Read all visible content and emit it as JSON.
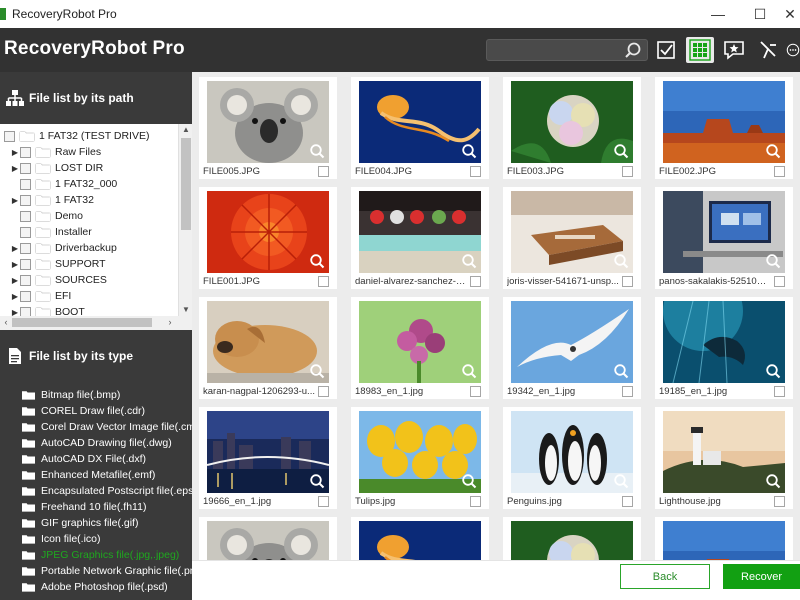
{
  "window": {
    "title": "RecoveryRobot Pro",
    "minimize_glyph": "—",
    "maximize_glyph": "☐",
    "close_glyph": "✕"
  },
  "header": {
    "app_title": "RecoveryRobot Pro",
    "search_value": "",
    "toolbar_icons": [
      "search-icon",
      "select-all-icon",
      "grid-view-icon",
      "preview-icon",
      "filter-icon",
      "more-icon"
    ]
  },
  "path_panel": {
    "title": "File list by its path",
    "tree": [
      {
        "label": "1 FAT32 (TEST DRIVE)",
        "arrow": "",
        "root": true
      },
      {
        "label": "Raw Files",
        "arrow": "▶"
      },
      {
        "label": "LOST DIR",
        "arrow": "▶"
      },
      {
        "label": "1 FAT32_000",
        "arrow": ""
      },
      {
        "label": "1 FAT32",
        "arrow": "▶"
      },
      {
        "label": "Demo",
        "arrow": ""
      },
      {
        "label": "Installer",
        "arrow": ""
      },
      {
        "label": "Driverbackup",
        "arrow": "▶"
      },
      {
        "label": "SUPPORT",
        "arrow": "▶"
      },
      {
        "label": "SOURCES",
        "arrow": "▶"
      },
      {
        "label": "EFI",
        "arrow": "▶"
      },
      {
        "label": "BOOT",
        "arrow": "▶"
      }
    ]
  },
  "type_panel": {
    "title": "File list by its type",
    "items": [
      {
        "label": "Bitmap file(.bmp)"
      },
      {
        "label": "COREL Draw file(.cdr)"
      },
      {
        "label": "Corel Draw Vector Image file(.cmx)"
      },
      {
        "label": "AutoCAD Drawing file(.dwg)"
      },
      {
        "label": "AutoCAD DX File(.dxf)"
      },
      {
        "label": "Enhanced Metafile(.emf)"
      },
      {
        "label": "Encapsulated Postscript file(.eps)"
      },
      {
        "label": "Freehand 10 file(.fh11)"
      },
      {
        "label": "GIF graphics file(.gif)"
      },
      {
        "label": "Icon file(.ico)"
      },
      {
        "label": "JPEG Graphics file(.jpg,.jpeg)",
        "selected": true
      },
      {
        "label": "Portable Network Graphic file(.png)"
      },
      {
        "label": "Adobe Photoshop file(.psd)"
      }
    ]
  },
  "files": [
    {
      "name": "FILE005.JPG",
      "scene": "koala"
    },
    {
      "name": "FILE004.JPG",
      "scene": "jellyfish"
    },
    {
      "name": "FILE003.JPG",
      "scene": "hydrangea"
    },
    {
      "name": "FILE002.JPG",
      "scene": "desert"
    },
    {
      "name": "FILE001.JPG",
      "scene": "chrysanthemum"
    },
    {
      "name": "daniel-alvarez-sanchez-d...",
      "scene": "bowling"
    },
    {
      "name": "joris-visser-541671-unsp...",
      "scene": "box"
    },
    {
      "name": "panos-sakalakis-525108-...",
      "scene": "desk"
    },
    {
      "name": "karan-nagpal-1206293-u...",
      "scene": "dog"
    },
    {
      "name": "18983_en_1.jpg",
      "scene": "flower"
    },
    {
      "name": "19342_en_1.jpg",
      "scene": "gull"
    },
    {
      "name": "19185_en_1.jpg",
      "scene": "dolphin"
    },
    {
      "name": "19666_en_1.jpg",
      "scene": "city"
    },
    {
      "name": "Tulips.jpg",
      "scene": "tulips"
    },
    {
      "name": "Penguins.jpg",
      "scene": "penguins"
    },
    {
      "name": "Lighthouse.jpg",
      "scene": "lighthouse"
    },
    {
      "name": "",
      "scene": "koala"
    },
    {
      "name": "",
      "scene": "jellyfish"
    },
    {
      "name": "",
      "scene": "hydrangea"
    },
    {
      "name": "",
      "scene": "desert"
    }
  ],
  "footer": {
    "back_label": "Back",
    "recover_label": "Recover"
  },
  "colors": {
    "accent_green": "#12a012",
    "header_bg": "#323232",
    "panel_bg": "#3a3a3a",
    "selected_type": "#1fa81f"
  }
}
